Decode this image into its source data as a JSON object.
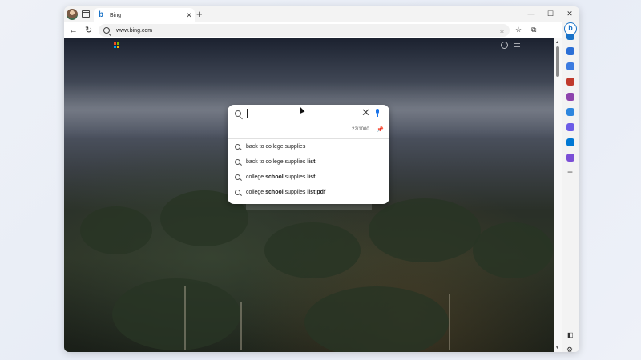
{
  "tab": {
    "title": "Bing",
    "close": "✕",
    "new_tab": "+"
  },
  "window_controls": {
    "minimize": "—",
    "maximize": "☐",
    "close": "✕"
  },
  "toolbar": {
    "back": "←",
    "refresh": "↻",
    "url": "www.bing.com"
  },
  "search": {
    "value": "",
    "counter": "22/1000",
    "clear": "✕",
    "suggestions": [
      {
        "parts": [
          "back to college supplies"
        ]
      },
      {
        "parts": [
          "back to college supplies ",
          "list"
        ]
      },
      {
        "parts": [
          "college ",
          "school",
          " supplies ",
          "list"
        ]
      },
      {
        "parts": [
          "college ",
          "school",
          " supplies ",
          "list pdf"
        ]
      }
    ]
  },
  "colors": {
    "accent": "#1a73e8",
    "sidebar_icons": [
      "#1a73c8",
      "#2b6fd6",
      "#3c7be0",
      "#c0392b",
      "#8e44ad",
      "#2e86de",
      "#6c5ce7",
      "#0078d4",
      "#7b4fd6"
    ]
  }
}
